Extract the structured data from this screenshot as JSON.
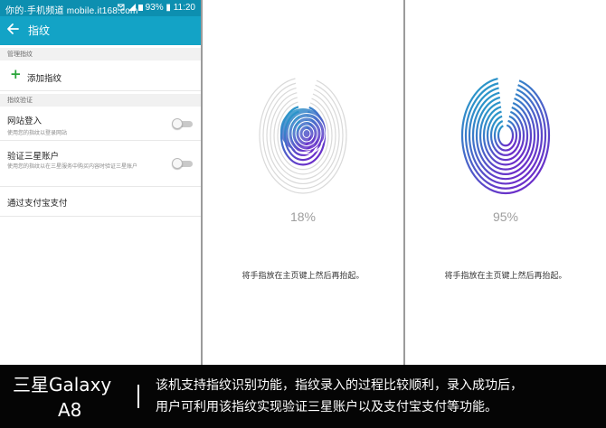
{
  "status_bar": {
    "left_text": "你的·手机频道 mobile.it168.com",
    "icons": "✉ ▮ 📶",
    "battery": "93%",
    "time": "11:20"
  },
  "app_bar": {
    "title": "指纹",
    "back_icon": "arrow-left-icon"
  },
  "sections": {
    "manage": "管理指纹",
    "verify": "指纹验证"
  },
  "add_fingerprint": {
    "label": "添加指纹",
    "icon": "plus-icon"
  },
  "options": [
    {
      "title": "网站登入",
      "subtitle": "使用您的指纹以登录网站",
      "enabled": false
    },
    {
      "title": "验证三星账户",
      "subtitle": "使用您的指纹以在三星服务中购买内容时验证三星账户",
      "enabled": false
    }
  ],
  "alipay": {
    "label": "通过支付宝支付"
  },
  "enroll_screens": [
    {
      "percent": "18%",
      "progress": 0.18,
      "hint": "将手指放在主页键上然后再抬起。"
    },
    {
      "percent": "95%",
      "progress": 0.95,
      "hint": "将手指放在主页键上然后再抬起。"
    }
  ],
  "colors": {
    "status_bar": "#0d8fb0",
    "app_bar": "#13a3c6",
    "accent_add": "#2aa53a",
    "fingerprint_start": "#1fa8c9",
    "fingerprint_end": "#6a2fc9",
    "fingerprint_inactive": "#d9d9d9"
  },
  "caption": {
    "model_line1": "三星Galaxy",
    "model_line2": "A8",
    "line1": "该机支持指纹识别功能，指纹录入的过程比较顺利，录入成功后，",
    "line2": "用户可利用该指纹实现验证三星账户以及支付宝支付等功能。"
  }
}
